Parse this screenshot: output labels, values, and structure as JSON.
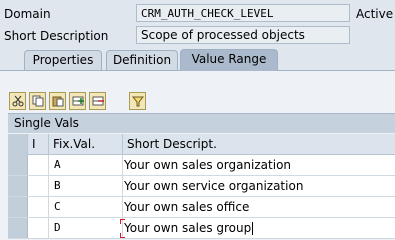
{
  "domain": {
    "label": "Domain",
    "value": "CRM_AUTH_CHECK_LEVEL",
    "status": "Active"
  },
  "short_description": {
    "label": "Short Description",
    "value": "Scope of processed objects"
  },
  "tabs": [
    {
      "label": "Properties",
      "active": false
    },
    {
      "label": "Definition",
      "active": false
    },
    {
      "label": "Value Range",
      "active": true
    }
  ],
  "toolbar": {
    "icons": [
      "cut-icon",
      "copy-icon",
      "paste-icon",
      "insert-row-icon",
      "delete-row-icon",
      "filter-icon"
    ]
  },
  "grid": {
    "title": "Single Vals",
    "headers": {
      "i": "I",
      "fix": "Fix.Val.",
      "desc": "Short Descript."
    },
    "rows": [
      {
        "fix": "A",
        "desc": "Your own sales organization"
      },
      {
        "fix": "B",
        "desc": "Your own service organization"
      },
      {
        "fix": "C",
        "desc": "Your own sales office"
      },
      {
        "fix": "D",
        "desc": "Your own sales group"
      }
    ]
  }
}
